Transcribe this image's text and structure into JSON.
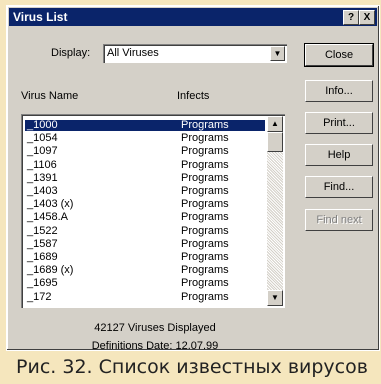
{
  "window": {
    "title": "Virus List",
    "help_btn": "?",
    "close_btn": "X"
  },
  "display": {
    "label": "Display:",
    "value": "All Viruses"
  },
  "columns": {
    "name": "Virus Name",
    "infects": "Infects"
  },
  "buttons": {
    "close": "Close",
    "info": "Info...",
    "print": "Print...",
    "help": "Help",
    "find": "Find...",
    "find_next": "Find next"
  },
  "viruses": [
    {
      "name": "_1000",
      "infects": "Programs"
    },
    {
      "name": "_1054",
      "infects": "Programs"
    },
    {
      "name": "_1097",
      "infects": "Programs"
    },
    {
      "name": "_1106",
      "infects": "Programs"
    },
    {
      "name": "_1391",
      "infects": "Programs"
    },
    {
      "name": "_1403",
      "infects": "Programs"
    },
    {
      "name": "_1403 (x)",
      "infects": "Programs"
    },
    {
      "name": "_1458.A",
      "infects": "Programs"
    },
    {
      "name": "_1522",
      "infects": "Programs"
    },
    {
      "name": "_1587",
      "infects": "Programs"
    },
    {
      "name": "_1689",
      "infects": "Programs"
    },
    {
      "name": "_1689 (x)",
      "infects": "Programs"
    },
    {
      "name": "_1695",
      "infects": "Programs"
    },
    {
      "name": "_172",
      "infects": "Programs"
    }
  ],
  "status": {
    "count": "42127 Viruses Displayed",
    "defs": "Definitions Date: 12.07.99"
  },
  "caption": "Рис. 32. Список известных вирусов"
}
